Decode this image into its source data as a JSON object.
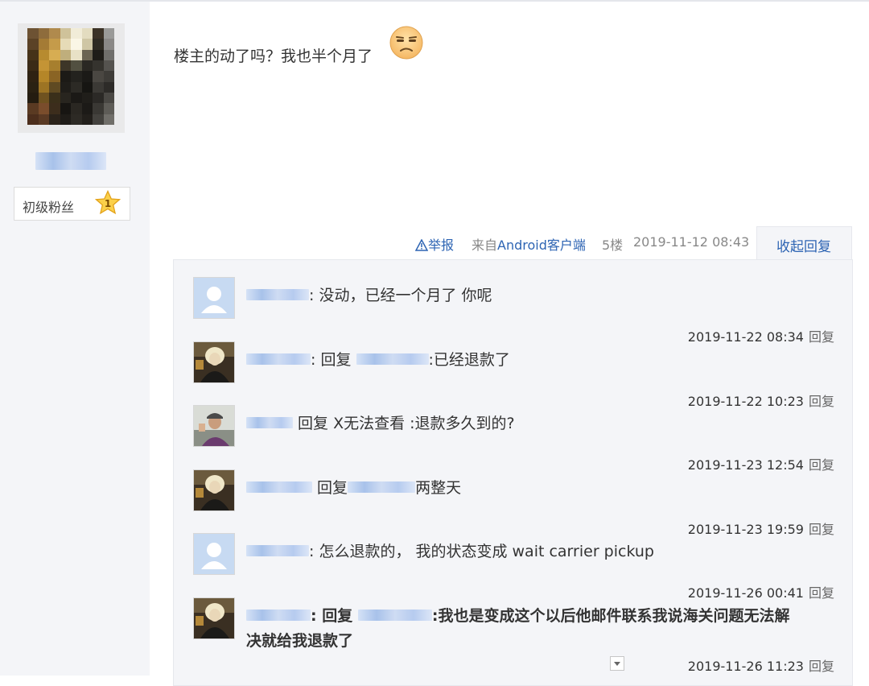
{
  "post": {
    "text": "楼主的动了吗？我也半个月了",
    "emoji": "unamused-face-icon"
  },
  "author": {
    "level_label": "初级粉丝",
    "level_number": "1"
  },
  "meta": {
    "report": "举报",
    "from_prefix": "来自",
    "client": "Android客户端",
    "floor": "5楼",
    "time": "2019-11-12 08:43",
    "collapse": "收起回复"
  },
  "replies": [
    {
      "prefix": "",
      "text": ": 没动，已经一个月了 你呢",
      "time": "2019-11-22 08:34",
      "reply_label": "回复",
      "avatar": "default-user-icon"
    },
    {
      "prefix": ": 回复",
      "text": ":已经退款了",
      "time": "2019-11-22 10:23",
      "reply_label": "回复",
      "avatar": "blonde-character-avatar"
    },
    {
      "prefix": "回复 X无法查看",
      "text": ":退款多久到的?",
      "time": "2019-11-23 12:54",
      "reply_label": "回复",
      "avatar": "man-photo-avatar"
    },
    {
      "prefix": "回复",
      "text": "两整天",
      "time": "2019-11-23 19:59",
      "reply_label": "回复",
      "avatar": "blonde-character-avatar"
    },
    {
      "prefix": "",
      "text": ": 怎么退款的， 我的状态变成 wait carrier pickup",
      "time": "2019-11-26 00:41",
      "reply_label": "回复",
      "avatar": "default-user-icon"
    },
    {
      "prefix": ": 回复",
      "text": ":我也是变成这个以后他邮件联系我说海关问题无法解",
      "text2": "决就给我退款了",
      "time": "2019-11-26 11:23",
      "reply_label": "回复",
      "avatar": "blonde-character-avatar"
    }
  ]
}
